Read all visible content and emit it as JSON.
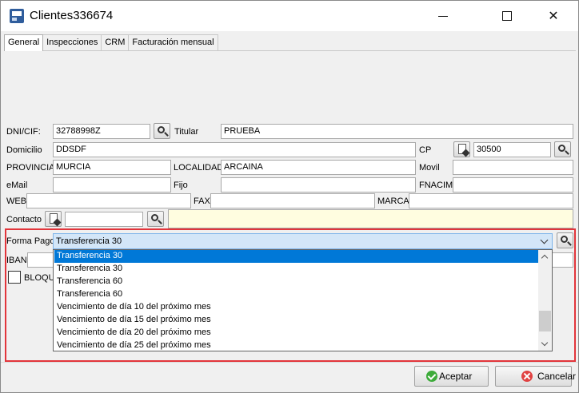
{
  "window": {
    "title": "Clientes336674"
  },
  "tabs": [
    {
      "label": "General"
    },
    {
      "label": "Inspecciones"
    },
    {
      "label": "CRM"
    },
    {
      "label": "Facturación mensual"
    }
  ],
  "form": {
    "dni_label": "DNI/CIF:",
    "dni_value": "32788998Z",
    "titular_label": "Titular",
    "titular_value": "PRUEBA",
    "domicilio_label": "Domicilio",
    "domicilio_value": "DDSDF",
    "cp_label": "CP",
    "cp_value": "30500",
    "provincia_label": "PROVINCIA",
    "provincia_value": "MURCIA",
    "localidad_label": "LOCALIDAD",
    "localidad_value": "ARCAINA",
    "movil_label": "Movil",
    "movil_value": "",
    "email_label": "eMail",
    "email_value": "",
    "fijo_label": "Fijo",
    "fijo_value": "",
    "fnacim_label": "FNACIM",
    "fnacim_value": "",
    "web_label": "WEB",
    "web_value": "",
    "fax_label": "FAX",
    "fax_value": "",
    "marca_label": "MARCA",
    "marca_value": "",
    "contacto_label": "Contacto",
    "contacto_value": "",
    "forma_pago_label": "Forma Pago",
    "forma_pago_value": "Transferencia 30",
    "iban_label": "IBAN",
    "bloqueado_label": "BLOQUE"
  },
  "dropdown": {
    "options": [
      "Transferencia 30",
      "Transferencia 30",
      "Transferencia 60",
      "Transferencia 60",
      "Vencimiento de día 10 del próximo mes",
      "Vencimiento de día 15 del próximo mes",
      "Vencimiento de día 20 del próximo mes",
      "Vencimiento de día 25 del próximo mes"
    ],
    "selected_index": 0
  },
  "footer": {
    "accept_label": "Aceptar",
    "cancel_label": "Cancelar"
  },
  "colors": {
    "highlight": "#e2353b",
    "selection": "#0078d7",
    "combo_bg": "#d3e6f8",
    "contacto_bg": "#fffde0"
  }
}
